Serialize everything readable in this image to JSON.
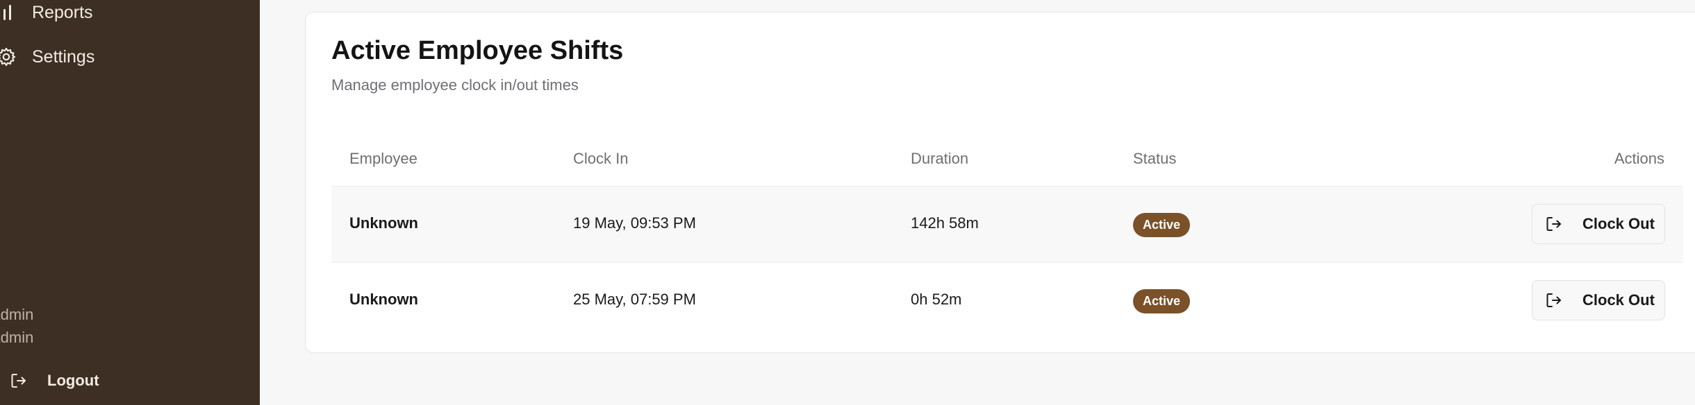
{
  "sidebar": {
    "nav": [
      {
        "label": "Reports",
        "icon": "bar-chart-icon"
      },
      {
        "label": "Settings",
        "icon": "gear-icon"
      }
    ],
    "user": {
      "name": "Admin",
      "role": "Admin"
    },
    "logout_label": "Logout"
  },
  "card": {
    "title": "Active Employee Shifts",
    "subtitle": "Manage employee clock in/out times"
  },
  "table": {
    "columns": [
      "Employee",
      "Clock In",
      "Duration",
      "Status",
      "Actions"
    ],
    "rows": [
      {
        "employee": "Unknown",
        "clock_in": "19 May, 09:53 PM",
        "duration": "142h 58m",
        "status": "Active",
        "action": "Clock Out"
      },
      {
        "employee": "Unknown",
        "clock_in": "25 May, 07:59 PM",
        "duration": "0h 52m",
        "status": "Active",
        "action": "Clock Out"
      }
    ]
  },
  "colors": {
    "sidebar_bg": "#3d2f23",
    "badge_bg": "#7a5128",
    "page_bg": "#f7f7f8"
  }
}
